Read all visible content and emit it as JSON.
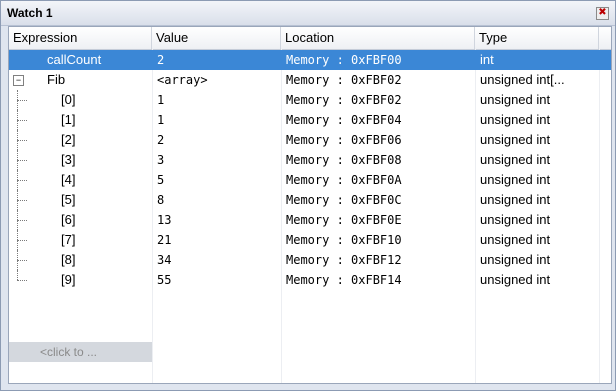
{
  "window": {
    "title": "Watch 1",
    "close_glyph": "✖"
  },
  "columns": [
    "Expression",
    "Value",
    "Location",
    "Type"
  ],
  "rows": [
    {
      "expr": "callCount",
      "value": "2",
      "location": "Memory : 0xFBF00",
      "type": "int",
      "selected": true
    },
    {
      "expr": "Fib",
      "value": "<array>",
      "location": "Memory : 0xFBF02",
      "type": "unsigned int[...",
      "expander": "⊟"
    },
    {
      "expr": "[0]",
      "value": "1",
      "location": "Memory : 0xFBF02",
      "type": "unsigned int"
    },
    {
      "expr": "[1]",
      "value": "1",
      "location": "Memory : 0xFBF04",
      "type": "unsigned int"
    },
    {
      "expr": "[2]",
      "value": "2",
      "location": "Memory : 0xFBF06",
      "type": "unsigned int"
    },
    {
      "expr": "[3]",
      "value": "3",
      "location": "Memory : 0xFBF08",
      "type": "unsigned int"
    },
    {
      "expr": "[4]",
      "value": "5",
      "location": "Memory : 0xFBF0A",
      "type": "unsigned int"
    },
    {
      "expr": "[5]",
      "value": "8",
      "location": "Memory : 0xFBF0C",
      "type": "unsigned int"
    },
    {
      "expr": "[6]",
      "value": "13",
      "location": "Memory : 0xFBF0E",
      "type": "unsigned int"
    },
    {
      "expr": "[7]",
      "value": "21",
      "location": "Memory : 0xFBF10",
      "type": "unsigned int"
    },
    {
      "expr": "[8]",
      "value": "34",
      "location": "Memory : 0xFBF12",
      "type": "unsigned int"
    },
    {
      "expr": "[9]",
      "value": "55",
      "location": "Memory : 0xFBF14",
      "type": "unsigned int"
    }
  ],
  "add_row_placeholder": "<click to ...",
  "colors": {
    "selection": "#3b87d6",
    "header": "#eef0f4"
  }
}
